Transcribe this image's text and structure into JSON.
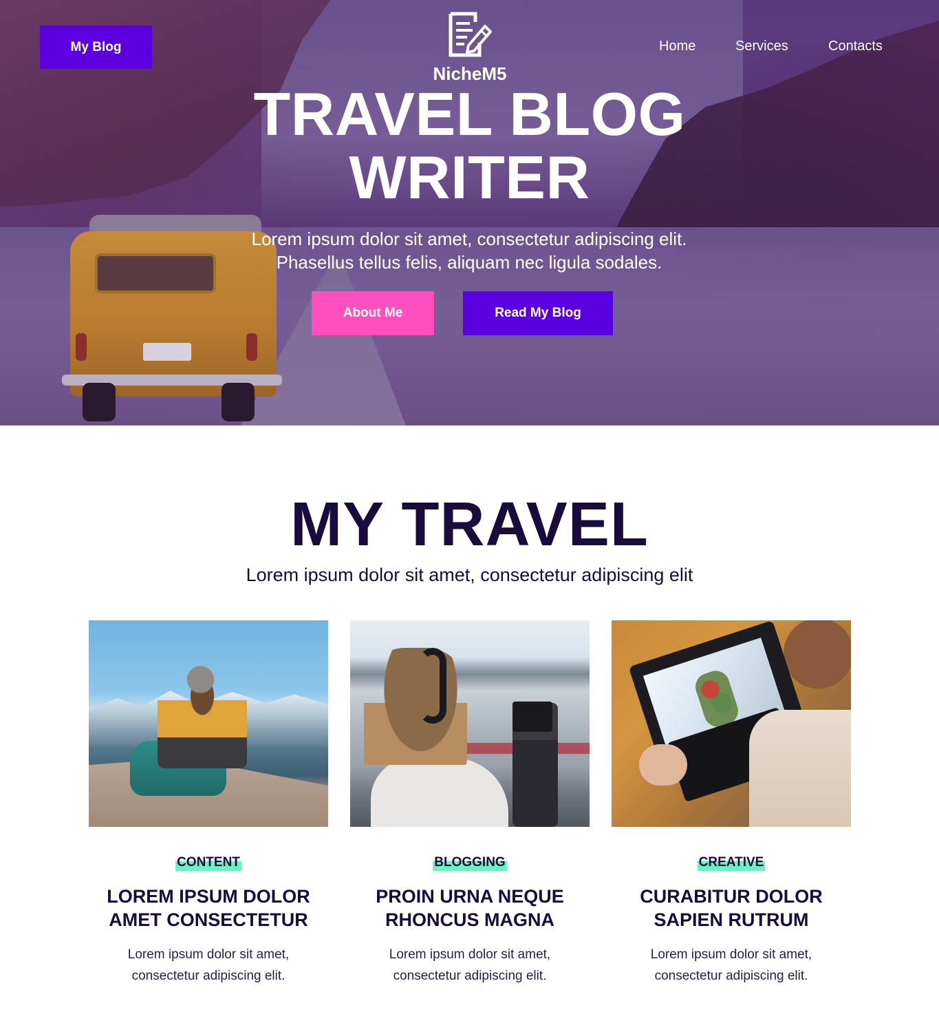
{
  "header": {
    "brand_button": "My Blog",
    "logo_text": "NicheM5",
    "nav": [
      "Home",
      "Services",
      "Contacts"
    ]
  },
  "hero": {
    "title_line1": "TRAVEL BLOG",
    "title_line2": "WRITER",
    "subtitle": "Lorem ipsum dolor sit amet, consectetur adipiscing elit. Phasellus tellus felis, aliquam nec ligula sodales.",
    "button_about": "About Me",
    "button_read": "Read My Blog"
  },
  "section": {
    "title": "MY TRAVEL",
    "subtitle": "Lorem ipsum dolor sit amet, consectetur adipiscing elit"
  },
  "cards": [
    {
      "tag": "CONTENT",
      "title": "LOREM IPSUM DOLOR AMET CONSECTETUR",
      "text": "Lorem ipsum dolor sit amet, consectetur adipiscing elit."
    },
    {
      "tag": "BLOGGING",
      "title": "PROIN URNA NEQUE RHONCUS MAGNA",
      "text": "Lorem ipsum dolor sit amet, consectetur adipiscing elit."
    },
    {
      "tag": "CREATIVE",
      "title": "CURABITUR DOLOR SAPIEN RUTRUM",
      "text": "Lorem ipsum dolor sit amet, consectetur adipiscing elit."
    }
  ],
  "colors": {
    "primary": "#5b00e0",
    "pink": "#ff4fbf",
    "dark_text": "#1a0b3d",
    "tag_highlight": "#6cf2c2"
  },
  "icons": {
    "logo": "document-pen-icon"
  }
}
